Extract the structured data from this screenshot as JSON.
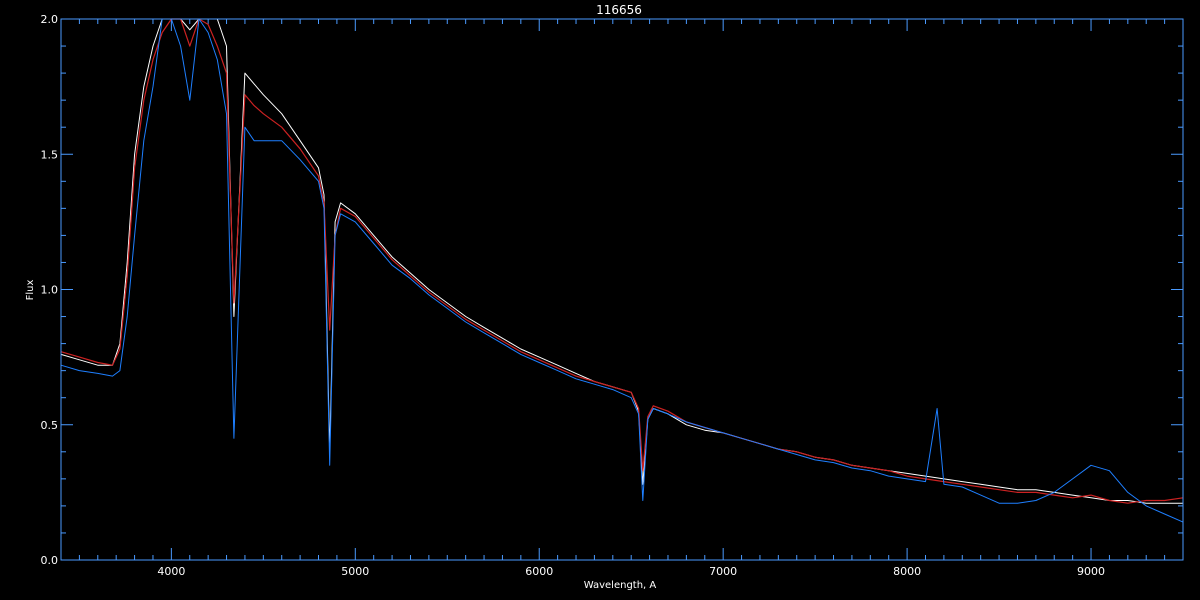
{
  "chart_data": {
    "type": "line",
    "title": "116656",
    "xlabel": "Wavelength, A",
    "ylabel": "Flux",
    "xlim": [
      3400,
      9500
    ],
    "ylim": [
      0.0,
      2.0
    ],
    "x_ticks": [
      4000,
      5000,
      6000,
      7000,
      8000,
      9000
    ],
    "y_ticks": [
      0.0,
      0.5,
      1.0,
      1.5,
      2.0
    ],
    "x_tick_labels": [
      "4000",
      "5000",
      "6000",
      "7000",
      "8000",
      "9000"
    ],
    "y_tick_labels": [
      "0.0",
      "0.5",
      "1.0",
      "1.5",
      "2.0"
    ],
    "grid": false,
    "background": "#000000",
    "axis_color": "#4a9aff",
    "series": [
      {
        "color": "#ffffff",
        "x": [
          3400,
          3500,
          3600,
          3680,
          3720,
          3760,
          3800,
          3850,
          3900,
          3950,
          4000,
          4050,
          4100,
          4150,
          4200,
          4250,
          4300,
          4340,
          4400,
          4450,
          4500,
          4600,
          4700,
          4800,
          4830,
          4861,
          4890,
          4920,
          5000,
          5100,
          5200,
          5300,
          5400,
          5500,
          5600,
          5700,
          5800,
          5900,
          6000,
          6100,
          6200,
          6300,
          6400,
          6500,
          6540,
          6563,
          6590,
          6620,
          6700,
          6800,
          6900,
          7000,
          7100,
          7200,
          7300,
          7400,
          7500,
          7600,
          7700,
          7800,
          7900,
          8000,
          8100,
          8200,
          8300,
          8400,
          8500,
          8600,
          8700,
          8800,
          8900,
          9000,
          9100,
          9200,
          9300,
          9400,
          9500
        ],
        "y": [
          0.76,
          0.74,
          0.72,
          0.72,
          0.8,
          1.1,
          1.5,
          1.75,
          1.9,
          2.0,
          2.0,
          2.0,
          1.96,
          2.0,
          2.0,
          2.0,
          1.9,
          0.9,
          1.8,
          1.76,
          1.72,
          1.65,
          1.55,
          1.45,
          1.35,
          0.4,
          1.25,
          1.32,
          1.28,
          1.2,
          1.12,
          1.06,
          1.0,
          0.95,
          0.9,
          0.86,
          0.82,
          0.78,
          0.75,
          0.72,
          0.69,
          0.66,
          0.64,
          0.62,
          0.55,
          0.28,
          0.52,
          0.56,
          0.54,
          0.5,
          0.48,
          0.47,
          0.45,
          0.43,
          0.41,
          0.4,
          0.38,
          0.37,
          0.35,
          0.34,
          0.33,
          0.32,
          0.31,
          0.3,
          0.29,
          0.28,
          0.27,
          0.26,
          0.26,
          0.25,
          0.24,
          0.23,
          0.22,
          0.22,
          0.21,
          0.21,
          0.21
        ]
      },
      {
        "color": "#cc2222",
        "x": [
          3400,
          3500,
          3600,
          3680,
          3720,
          3760,
          3800,
          3850,
          3900,
          3950,
          4000,
          4050,
          4100,
          4150,
          4200,
          4250,
          4300,
          4340,
          4400,
          4450,
          4500,
          4600,
          4700,
          4800,
          4830,
          4861,
          4890,
          4920,
          5000,
          5100,
          5200,
          5300,
          5400,
          5500,
          5600,
          5700,
          5800,
          5900,
          6000,
          6100,
          6200,
          6300,
          6400,
          6500,
          6540,
          6563,
          6590,
          6620,
          6700,
          6800,
          6900,
          7000,
          7100,
          7200,
          7300,
          7400,
          7500,
          7600,
          7700,
          7800,
          7900,
          8000,
          8100,
          8200,
          8300,
          8400,
          8500,
          8600,
          8700,
          8800,
          8900,
          9000,
          9100,
          9200,
          9300,
          9400,
          9500
        ],
        "y": [
          0.77,
          0.75,
          0.73,
          0.72,
          0.78,
          1.05,
          1.45,
          1.7,
          1.85,
          1.95,
          2.0,
          2.0,
          1.9,
          2.0,
          1.98,
          1.9,
          1.8,
          0.95,
          1.72,
          1.68,
          1.65,
          1.6,
          1.52,
          1.42,
          1.32,
          0.85,
          1.2,
          1.3,
          1.27,
          1.19,
          1.11,
          1.05,
          0.99,
          0.94,
          0.89,
          0.85,
          0.81,
          0.77,
          0.74,
          0.71,
          0.68,
          0.66,
          0.64,
          0.62,
          0.56,
          0.33,
          0.53,
          0.57,
          0.55,
          0.51,
          0.49,
          0.47,
          0.45,
          0.43,
          0.41,
          0.4,
          0.38,
          0.37,
          0.35,
          0.34,
          0.33,
          0.31,
          0.3,
          0.29,
          0.28,
          0.27,
          0.26,
          0.25,
          0.25,
          0.24,
          0.23,
          0.24,
          0.22,
          0.21,
          0.22,
          0.22,
          0.23
        ]
      },
      {
        "color": "#1e7fff",
        "x": [
          3400,
          3500,
          3600,
          3680,
          3720,
          3760,
          3800,
          3850,
          3900,
          3950,
          4000,
          4050,
          4100,
          4150,
          4200,
          4250,
          4300,
          4340,
          4400,
          4450,
          4500,
          4600,
          4700,
          4800,
          4830,
          4861,
          4890,
          4920,
          5000,
          5100,
          5200,
          5300,
          5400,
          5500,
          5600,
          5700,
          5800,
          5900,
          6000,
          6100,
          6200,
          6300,
          6400,
          6500,
          6540,
          6563,
          6590,
          6620,
          6700,
          6800,
          6900,
          7000,
          7100,
          7200,
          7300,
          7400,
          7500,
          7600,
          7700,
          7800,
          7900,
          8000,
          8100,
          8163,
          8200,
          8300,
          8400,
          8500,
          8600,
          8700,
          8800,
          8900,
          9000,
          9100,
          9200,
          9300,
          9400,
          9500
        ],
        "y": [
          0.72,
          0.7,
          0.69,
          0.68,
          0.7,
          0.9,
          1.2,
          1.55,
          1.75,
          2.0,
          2.0,
          1.9,
          1.7,
          2.0,
          1.95,
          1.85,
          1.65,
          0.45,
          1.6,
          1.55,
          1.55,
          1.55,
          1.48,
          1.4,
          1.3,
          0.35,
          1.2,
          1.28,
          1.25,
          1.17,
          1.09,
          1.04,
          0.98,
          0.93,
          0.88,
          0.84,
          0.8,
          0.76,
          0.73,
          0.7,
          0.67,
          0.65,
          0.63,
          0.6,
          0.54,
          0.22,
          0.52,
          0.56,
          0.54,
          0.51,
          0.49,
          0.47,
          0.45,
          0.43,
          0.41,
          0.39,
          0.37,
          0.36,
          0.34,
          0.33,
          0.31,
          0.3,
          0.29,
          0.56,
          0.28,
          0.27,
          0.24,
          0.21,
          0.21,
          0.22,
          0.25,
          0.3,
          0.35,
          0.33,
          0.25,
          0.2,
          0.17,
          0.14
        ]
      }
    ]
  }
}
